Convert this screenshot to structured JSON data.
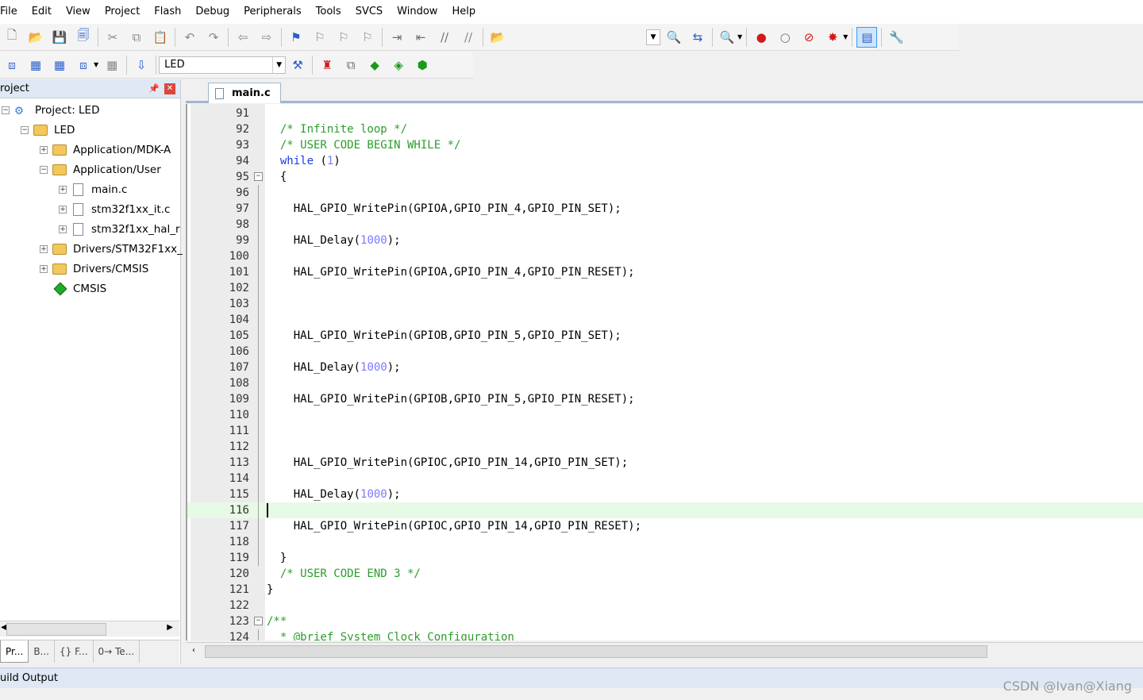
{
  "menu": [
    "File",
    "Edit",
    "View",
    "Project",
    "Flash",
    "Debug",
    "Peripherals",
    "Tools",
    "SVCS",
    "Window",
    "Help"
  ],
  "toolbar": {
    "target_name": "LED"
  },
  "project_panel": {
    "title": "roject",
    "tree": [
      {
        "label": "Project: LED",
        "expander": "−"
      },
      {
        "label": "LED",
        "expander": "−"
      },
      {
        "label": "Application/MDK-A",
        "expander": "+"
      },
      {
        "label": "Application/User",
        "expander": "−"
      },
      {
        "label": "main.c",
        "expander": "+"
      },
      {
        "label": "stm32f1xx_it.c",
        "expander": "+"
      },
      {
        "label": "stm32f1xx_hal_r",
        "expander": "+"
      },
      {
        "label": "Drivers/STM32F1xx_",
        "expander": "+"
      },
      {
        "label": "Drivers/CMSIS",
        "expander": "+"
      },
      {
        "label": "CMSIS",
        "expander": ""
      }
    ],
    "tabs": [
      "Pr...",
      "B...",
      "{} F...",
      "0→ Te..."
    ]
  },
  "editor": {
    "active_tab": "main.c",
    "current_line": "116",
    "lines": [
      {
        "n": "91",
        "t": ""
      },
      {
        "n": "92",
        "t": "  /* Infinite loop */"
      },
      {
        "n": "93",
        "t": "  /* USER CODE BEGIN WHILE */"
      },
      {
        "n": "94",
        "t": "  while (1)"
      },
      {
        "n": "95",
        "t": "  {"
      },
      {
        "n": "96",
        "t": ""
      },
      {
        "n": "97",
        "t": "    HAL_GPIO_WritePin(GPIOA,GPIO_PIN_4,GPIO_PIN_SET);"
      },
      {
        "n": "98",
        "t": ""
      },
      {
        "n": "99",
        "t": "    HAL_Delay(1000);"
      },
      {
        "n": "100",
        "t": ""
      },
      {
        "n": "101",
        "t": "    HAL_GPIO_WritePin(GPIOA,GPIO_PIN_4,GPIO_PIN_RESET);"
      },
      {
        "n": "102",
        "t": ""
      },
      {
        "n": "103",
        "t": ""
      },
      {
        "n": "104",
        "t": ""
      },
      {
        "n": "105",
        "t": "    HAL_GPIO_WritePin(GPIOB,GPIO_PIN_5,GPIO_PIN_SET);"
      },
      {
        "n": "106",
        "t": ""
      },
      {
        "n": "107",
        "t": "    HAL_Delay(1000);"
      },
      {
        "n": "108",
        "t": ""
      },
      {
        "n": "109",
        "t": "    HAL_GPIO_WritePin(GPIOB,GPIO_PIN_5,GPIO_PIN_RESET);"
      },
      {
        "n": "110",
        "t": ""
      },
      {
        "n": "111",
        "t": ""
      },
      {
        "n": "112",
        "t": ""
      },
      {
        "n": "113",
        "t": "    HAL_GPIO_WritePin(GPIOC,GPIO_PIN_14,GPIO_PIN_SET);"
      },
      {
        "n": "114",
        "t": ""
      },
      {
        "n": "115",
        "t": "    HAL_Delay(1000);"
      },
      {
        "n": "116",
        "t": ""
      },
      {
        "n": "117",
        "t": "    HAL_GPIO_WritePin(GPIOC,GPIO_PIN_14,GPIO_PIN_RESET);"
      },
      {
        "n": "118",
        "t": ""
      },
      {
        "n": "119",
        "t": "  }"
      },
      {
        "n": "120",
        "t": "  /* USER CODE END 3 */"
      },
      {
        "n": "121",
        "t": "}"
      },
      {
        "n": "122",
        "t": ""
      },
      {
        "n": "123",
        "t": "/**"
      },
      {
        "n": "124",
        "t": "  * @brief System Clock Configuration"
      }
    ]
  },
  "build_output": {
    "title": "uild Output"
  },
  "watermark": "CSDN @Ivan@Xiang"
}
